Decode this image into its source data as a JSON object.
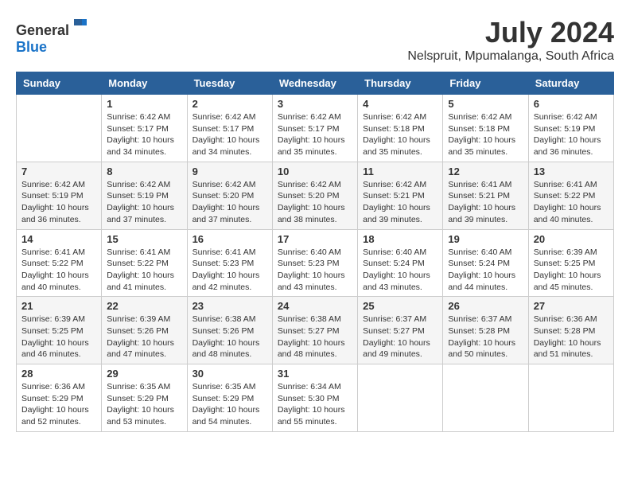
{
  "header": {
    "logo_general": "General",
    "logo_blue": "Blue",
    "month_year": "July 2024",
    "location": "Nelspruit, Mpumalanga, South Africa"
  },
  "weekdays": [
    "Sunday",
    "Monday",
    "Tuesday",
    "Wednesday",
    "Thursday",
    "Friday",
    "Saturday"
  ],
  "weeks": [
    [
      {
        "day": "",
        "info": ""
      },
      {
        "day": "1",
        "info": "Sunrise: 6:42 AM\nSunset: 5:17 PM\nDaylight: 10 hours\nand 34 minutes."
      },
      {
        "day": "2",
        "info": "Sunrise: 6:42 AM\nSunset: 5:17 PM\nDaylight: 10 hours\nand 34 minutes."
      },
      {
        "day": "3",
        "info": "Sunrise: 6:42 AM\nSunset: 5:17 PM\nDaylight: 10 hours\nand 35 minutes."
      },
      {
        "day": "4",
        "info": "Sunrise: 6:42 AM\nSunset: 5:18 PM\nDaylight: 10 hours\nand 35 minutes."
      },
      {
        "day": "5",
        "info": "Sunrise: 6:42 AM\nSunset: 5:18 PM\nDaylight: 10 hours\nand 35 minutes."
      },
      {
        "day": "6",
        "info": "Sunrise: 6:42 AM\nSunset: 5:19 PM\nDaylight: 10 hours\nand 36 minutes."
      }
    ],
    [
      {
        "day": "7",
        "info": "Sunrise: 6:42 AM\nSunset: 5:19 PM\nDaylight: 10 hours\nand 36 minutes."
      },
      {
        "day": "8",
        "info": "Sunrise: 6:42 AM\nSunset: 5:19 PM\nDaylight: 10 hours\nand 37 minutes."
      },
      {
        "day": "9",
        "info": "Sunrise: 6:42 AM\nSunset: 5:20 PM\nDaylight: 10 hours\nand 37 minutes."
      },
      {
        "day": "10",
        "info": "Sunrise: 6:42 AM\nSunset: 5:20 PM\nDaylight: 10 hours\nand 38 minutes."
      },
      {
        "day": "11",
        "info": "Sunrise: 6:42 AM\nSunset: 5:21 PM\nDaylight: 10 hours\nand 39 minutes."
      },
      {
        "day": "12",
        "info": "Sunrise: 6:41 AM\nSunset: 5:21 PM\nDaylight: 10 hours\nand 39 minutes."
      },
      {
        "day": "13",
        "info": "Sunrise: 6:41 AM\nSunset: 5:22 PM\nDaylight: 10 hours\nand 40 minutes."
      }
    ],
    [
      {
        "day": "14",
        "info": "Sunrise: 6:41 AM\nSunset: 5:22 PM\nDaylight: 10 hours\nand 40 minutes."
      },
      {
        "day": "15",
        "info": "Sunrise: 6:41 AM\nSunset: 5:22 PM\nDaylight: 10 hours\nand 41 minutes."
      },
      {
        "day": "16",
        "info": "Sunrise: 6:41 AM\nSunset: 5:23 PM\nDaylight: 10 hours\nand 42 minutes."
      },
      {
        "day": "17",
        "info": "Sunrise: 6:40 AM\nSunset: 5:23 PM\nDaylight: 10 hours\nand 43 minutes."
      },
      {
        "day": "18",
        "info": "Sunrise: 6:40 AM\nSunset: 5:24 PM\nDaylight: 10 hours\nand 43 minutes."
      },
      {
        "day": "19",
        "info": "Sunrise: 6:40 AM\nSunset: 5:24 PM\nDaylight: 10 hours\nand 44 minutes."
      },
      {
        "day": "20",
        "info": "Sunrise: 6:39 AM\nSunset: 5:25 PM\nDaylight: 10 hours\nand 45 minutes."
      }
    ],
    [
      {
        "day": "21",
        "info": "Sunrise: 6:39 AM\nSunset: 5:25 PM\nDaylight: 10 hours\nand 46 minutes."
      },
      {
        "day": "22",
        "info": "Sunrise: 6:39 AM\nSunset: 5:26 PM\nDaylight: 10 hours\nand 47 minutes."
      },
      {
        "day": "23",
        "info": "Sunrise: 6:38 AM\nSunset: 5:26 PM\nDaylight: 10 hours\nand 48 minutes."
      },
      {
        "day": "24",
        "info": "Sunrise: 6:38 AM\nSunset: 5:27 PM\nDaylight: 10 hours\nand 48 minutes."
      },
      {
        "day": "25",
        "info": "Sunrise: 6:37 AM\nSunset: 5:27 PM\nDaylight: 10 hours\nand 49 minutes."
      },
      {
        "day": "26",
        "info": "Sunrise: 6:37 AM\nSunset: 5:28 PM\nDaylight: 10 hours\nand 50 minutes."
      },
      {
        "day": "27",
        "info": "Sunrise: 6:36 AM\nSunset: 5:28 PM\nDaylight: 10 hours\nand 51 minutes."
      }
    ],
    [
      {
        "day": "28",
        "info": "Sunrise: 6:36 AM\nSunset: 5:29 PM\nDaylight: 10 hours\nand 52 minutes."
      },
      {
        "day": "29",
        "info": "Sunrise: 6:35 AM\nSunset: 5:29 PM\nDaylight: 10 hours\nand 53 minutes."
      },
      {
        "day": "30",
        "info": "Sunrise: 6:35 AM\nSunset: 5:29 PM\nDaylight: 10 hours\nand 54 minutes."
      },
      {
        "day": "31",
        "info": "Sunrise: 6:34 AM\nSunset: 5:30 PM\nDaylight: 10 hours\nand 55 minutes."
      },
      {
        "day": "",
        "info": ""
      },
      {
        "day": "",
        "info": ""
      },
      {
        "day": "",
        "info": ""
      }
    ]
  ]
}
